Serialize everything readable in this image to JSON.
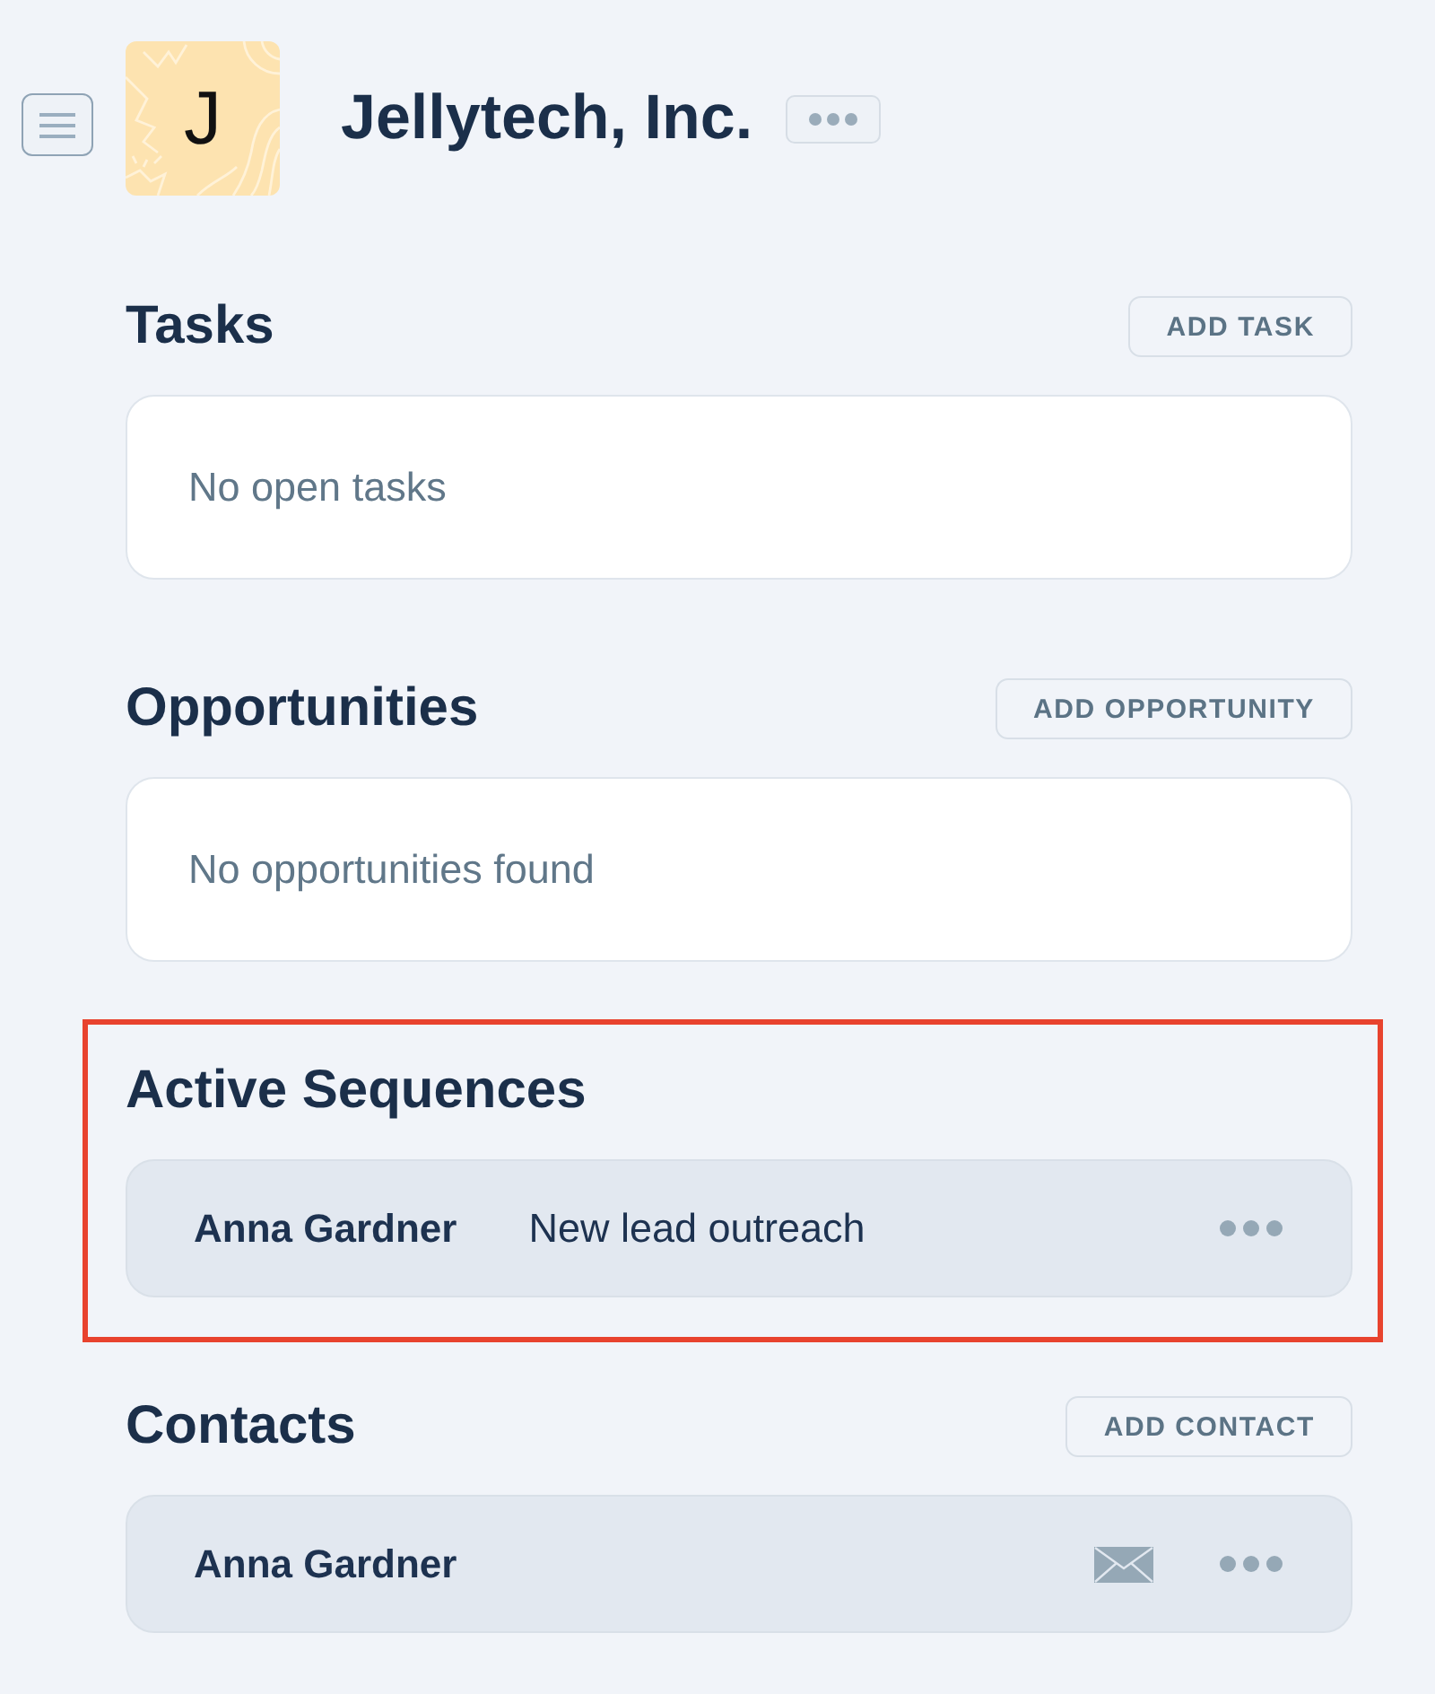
{
  "company": {
    "initial": "J",
    "name": "Jellytech, Inc."
  },
  "sections": [
    {
      "kind": "empty",
      "title": "Tasks",
      "action": "ADD TASK",
      "empty_text": "No open tasks",
      "highlighted": false
    },
    {
      "kind": "empty",
      "title": "Opportunities",
      "action": "ADD OPPORTUNITY",
      "empty_text": "No opportunities found",
      "highlighted": false
    },
    {
      "kind": "sequences",
      "title": "Active Sequences",
      "highlighted": true,
      "rows": [
        {
          "contact": "Anna Gardner",
          "sequence": "New lead outreach"
        }
      ]
    },
    {
      "kind": "contacts",
      "title": "Contacts",
      "action": "ADD CONTACT",
      "highlighted": false,
      "rows": [
        {
          "name": "Anna Gardner"
        }
      ]
    }
  ]
}
